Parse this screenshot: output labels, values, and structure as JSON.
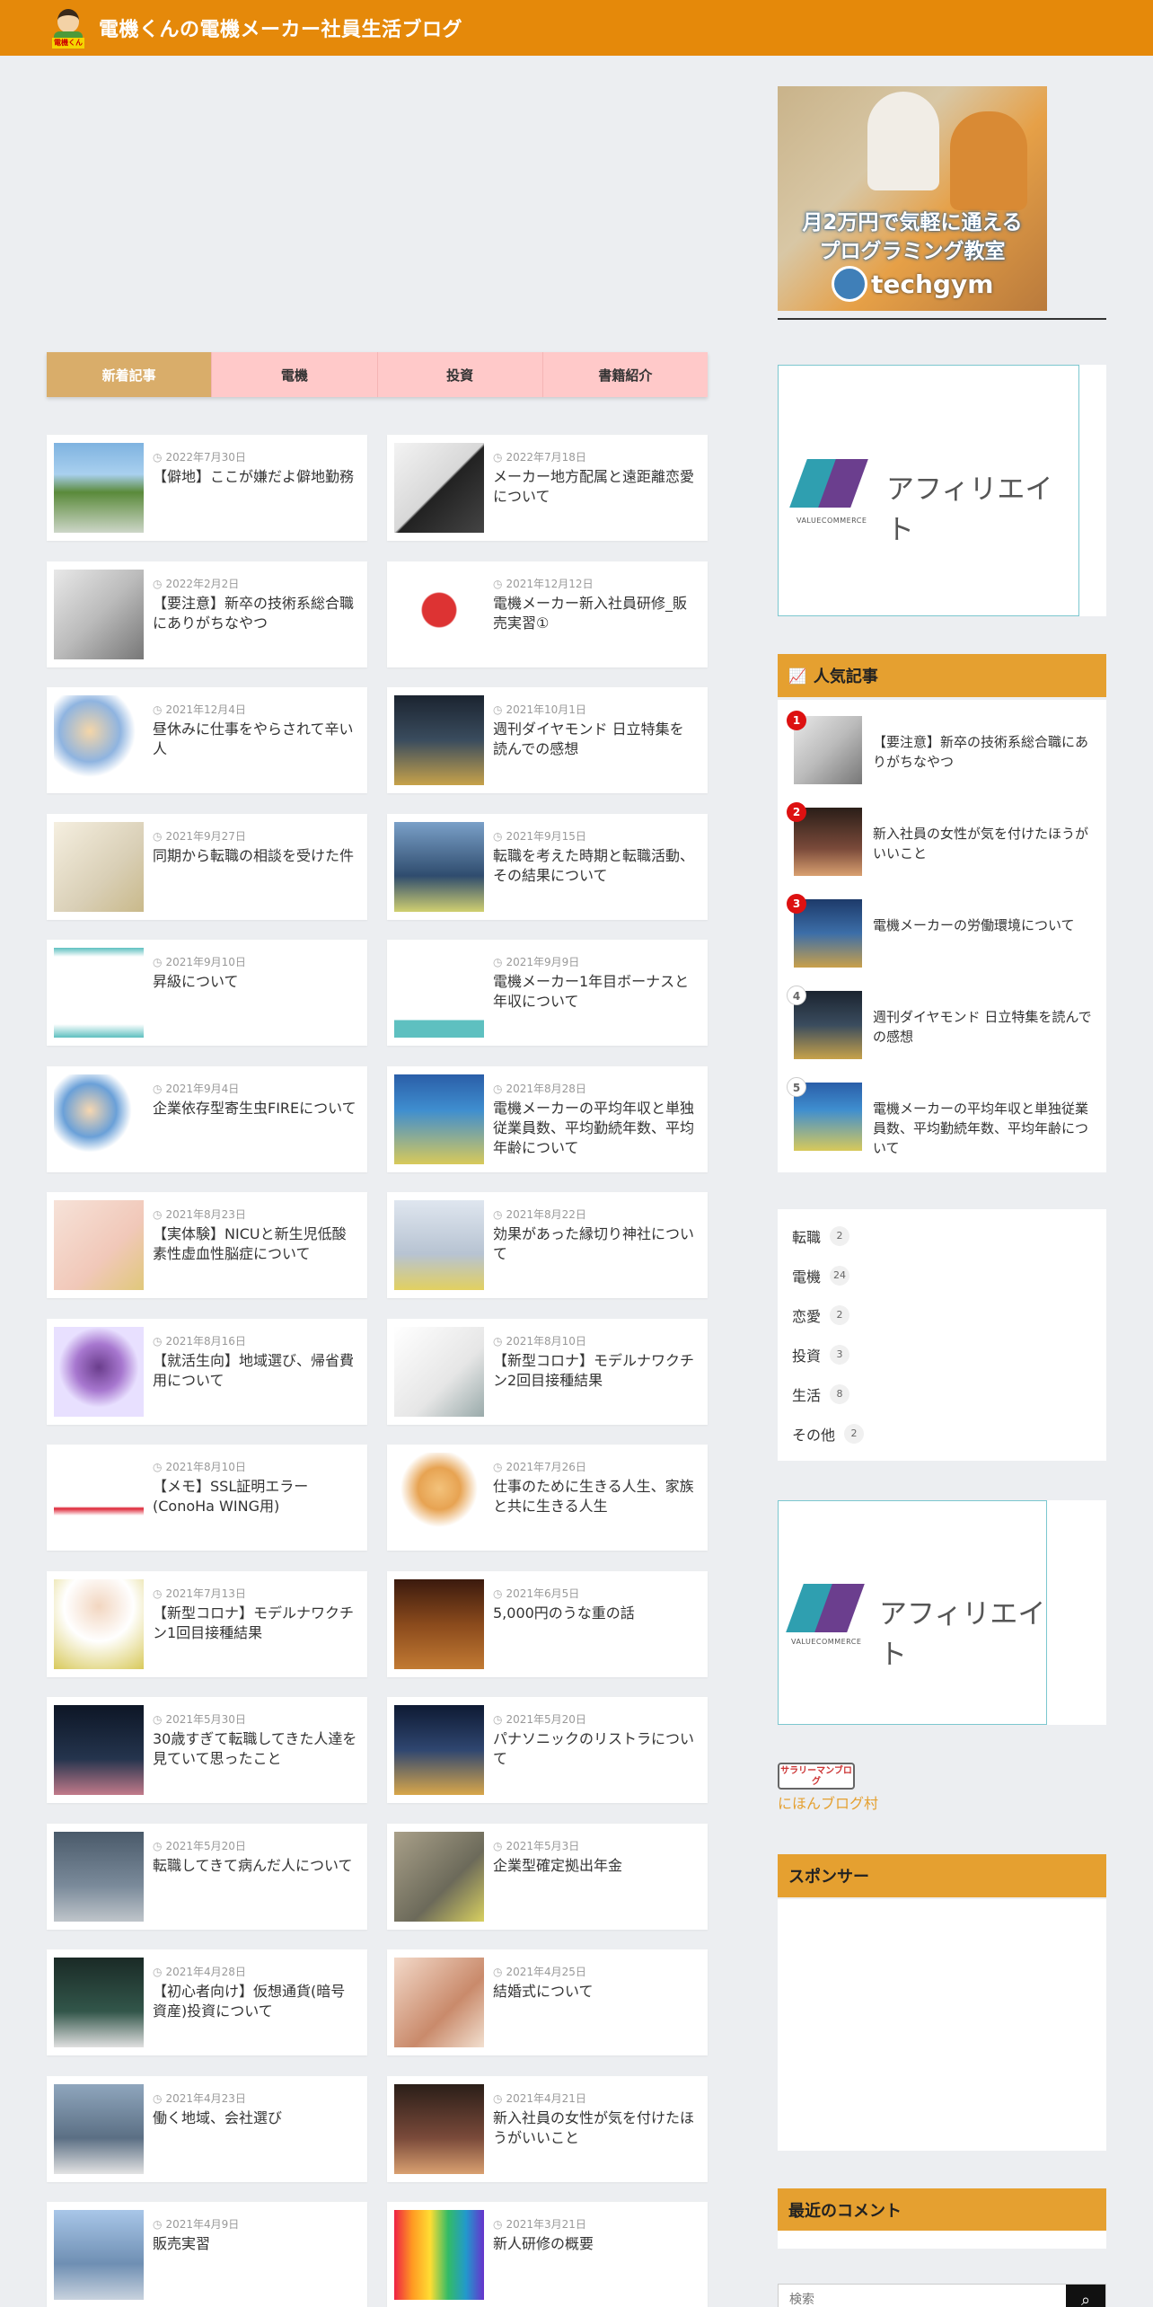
{
  "header": {
    "site_title": "電機くんの電機メーカー社員生活ブログ",
    "logo_text": "電機くん"
  },
  "ad_top": {
    "line1": "月2万円で気軽に通える",
    "line2": "プログラミング教室",
    "brand": "techgym"
  },
  "affiliate": {
    "word": "アフィリエイト",
    "sub": "VALUECOMMERCE"
  },
  "tabs": [
    "新着記事",
    "電機",
    "投資",
    "書籍紹介"
  ],
  "posts": [
    {
      "date": "2022年7月30日",
      "title": "【僻地】ここが嫌だよ僻地勤務"
    },
    {
      "date": "2022年7月18日",
      "title": "メーカー地方配属と遠距離恋愛について"
    },
    {
      "date": "2022年2月2日",
      "title": "【要注意】新卒の技術系総合職にありがちなやつ"
    },
    {
      "date": "2021年12月12日",
      "title": "電機メーカー新入社員研修_販売実習①"
    },
    {
      "date": "2021年12月4日",
      "title": "昼休みに仕事をやらされて辛い人"
    },
    {
      "date": "2021年10月1日",
      "title": "週刊ダイヤモンド 日立特集を読んでの感想"
    },
    {
      "date": "2021年9月27日",
      "title": "同期から転職の相談を受けた件"
    },
    {
      "date": "2021年9月15日",
      "title": "転職を考えた時期と転職活動、その結果について"
    },
    {
      "date": "2021年9月10日",
      "title": "昇級について"
    },
    {
      "date": "2021年9月9日",
      "title": "電機メーカー1年目ボーナスと年収について"
    },
    {
      "date": "2021年9月4日",
      "title": "企業依存型寄生虫FIREについて"
    },
    {
      "date": "2021年8月28日",
      "title": "電機メーカーの平均年収と単独従業員数、平均勤続年数、平均年齢について"
    },
    {
      "date": "2021年8月23日",
      "title": "【実体験】NICUと新生児低酸素性虚血性脳症について"
    },
    {
      "date": "2021年8月22日",
      "title": "効果があった縁切り神社について"
    },
    {
      "date": "2021年8月16日",
      "title": "【就活生向】地域選び、帰省費用について"
    },
    {
      "date": "2021年8月10日",
      "title": "【新型コロナ】モデルナワクチン2回目接種結果"
    },
    {
      "date": "2021年8月10日",
      "title": "【メモ】SSL証明エラー(ConoHa WING用)"
    },
    {
      "date": "2021年7月26日",
      "title": "仕事のために生きる人生、家族と共に生きる人生"
    },
    {
      "date": "2021年7月13日",
      "title": "【新型コロナ】モデルナワクチン1回目接種結果"
    },
    {
      "date": "2021年6月5日",
      "title": "5,000円のうな重の話"
    },
    {
      "date": "2021年5月30日",
      "title": "30歳すぎて転職してきた人達を見ていて思ったこと"
    },
    {
      "date": "2021年5月20日",
      "title": "パナソニックのリストラについて"
    },
    {
      "date": "2021年5月20日",
      "title": "転職してきて病んだ人について"
    },
    {
      "date": "2021年5月3日",
      "title": "企業型確定拠出年金"
    },
    {
      "date": "2021年4月28日",
      "title": "【初心者向け】仮想通貨(暗号資産)投資について"
    },
    {
      "date": "2021年4月25日",
      "title": "結婚式について"
    },
    {
      "date": "2021年4月23日",
      "title": "働く地域、会社選び"
    },
    {
      "date": "2021年4月21日",
      "title": "新入社員の女性が気を付けたほうがいいこと"
    },
    {
      "date": "2021年4月9日",
      "title": "販売実習"
    },
    {
      "date": "2021年3月21日",
      "title": "新人研修の概要"
    }
  ],
  "popular": {
    "heading": "人気記事",
    "items": [
      {
        "rank": "1",
        "title": "【要注意】新卒の技術系総合職にありがちなやつ"
      },
      {
        "rank": "2",
        "title": "新入社員の女性が気を付けたほうがいいこと"
      },
      {
        "rank": "3",
        "title": "電機メーカーの労働環境について"
      },
      {
        "rank": "4",
        "title": "週刊ダイヤモンド 日立特集を読んでの感想"
      },
      {
        "rank": "5",
        "title": "電機メーカーの平均年収と単独従業員数、平均勤続年数、平均年齢について"
      }
    ]
  },
  "categories": [
    {
      "name": "転職",
      "count": "2"
    },
    {
      "name": "電機",
      "count": "24"
    },
    {
      "name": "恋愛",
      "count": "2"
    },
    {
      "name": "投資",
      "count": "3"
    },
    {
      "name": "生活",
      "count": "8"
    },
    {
      "name": "その他",
      "count": "2"
    }
  ],
  "blog_badge": {
    "label": "サラリーマンブログ"
  },
  "blog_link": "にほんブログ村",
  "sponsor_heading": "スポンサー",
  "comments_heading": "最近のコメント",
  "search": {
    "placeholder": "検索"
  },
  "colors": {
    "accent": "#e5890a",
    "section": "#e5a030",
    "tab_active": "#d9ad6a",
    "tab_inactive": "#ffc9c9",
    "rank_badge": "#dd1111"
  }
}
